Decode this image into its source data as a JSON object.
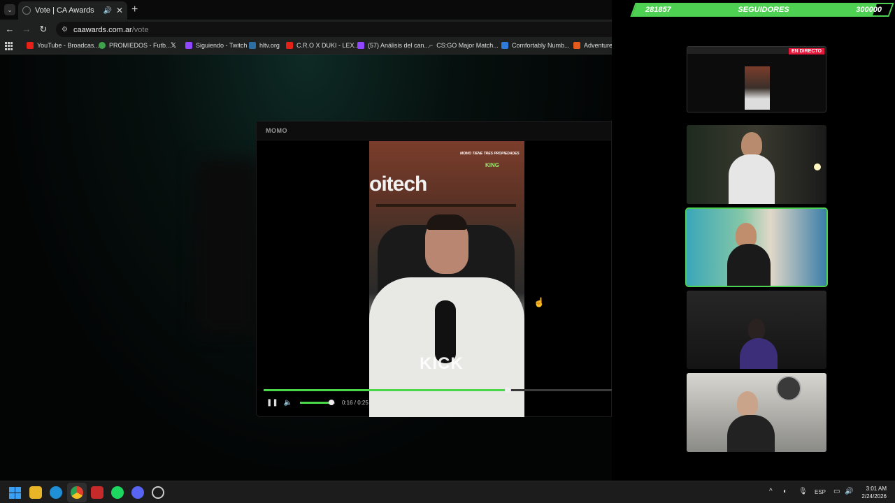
{
  "browser": {
    "tab": {
      "title": "Vote | CA Awards"
    },
    "url": {
      "host": "caawards.com.ar",
      "path": "/vote"
    },
    "bookmarks": [
      {
        "label": "YouTube - Broadcas...",
        "color": "#e62117"
      },
      {
        "label": "PROMIEDOS - Futb...",
        "color": "#3fa34d"
      },
      {
        "label": "",
        "color": "#ffffff"
      },
      {
        "label": "Siguiendo - Twitch",
        "color": "#9146ff"
      },
      {
        "label": "hltv.org",
        "color": "#2d6ea3"
      },
      {
        "label": "C.R.O X DUKI - LEX...",
        "color": "#e62117"
      },
      {
        "label": "(57) Análisis del can...",
        "color": "#9146ff"
      },
      {
        "label": "CS:GO Major Match...",
        "color": "#888888"
      },
      {
        "label": "Comfortably Numb...",
        "color": "#2f7bd8"
      },
      {
        "label": "Adventure",
        "color": "#e55b1e"
      }
    ]
  },
  "modal": {
    "title": "MOMO",
    "video": {
      "caption": "MOMO TIENE TRES PROPIEDADES",
      "logo_text": "oitech",
      "brand": "KING",
      "watermark": "KICK",
      "time": "0:16 / 0:25",
      "progress": 0.7,
      "volume": 0.9
    }
  },
  "overlay": {
    "goal": {
      "current": "281857",
      "label": "SEGUIDORES",
      "target": "300000",
      "progress": 0.94
    },
    "live_badge": "EN DIRECTO",
    "cams": [
      {
        "name": "cam-1"
      },
      {
        "name": "cam-2"
      },
      {
        "name": "cam-3"
      },
      {
        "name": "cam-4"
      },
      {
        "name": "cam-5"
      }
    ]
  },
  "taskbar": {
    "language": "ESP",
    "time": "3:01 AM",
    "date": "2/24/2026"
  },
  "colors": {
    "accent_green": "#4ed152",
    "live_red": "#e5173a"
  }
}
